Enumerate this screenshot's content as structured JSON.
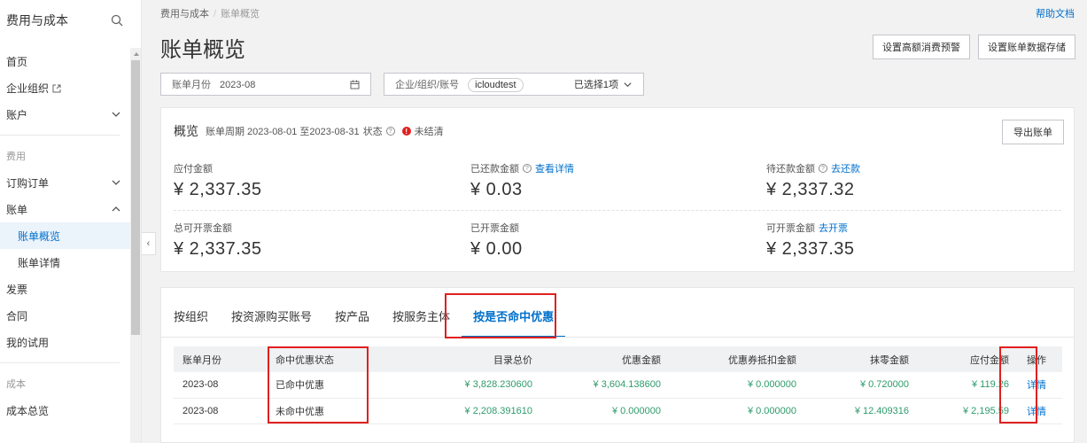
{
  "sidebar": {
    "title": "费用与成本",
    "items": [
      {
        "label": "首页"
      },
      {
        "label": "企业组织"
      },
      {
        "label": "账户"
      }
    ],
    "group_fee": "费用",
    "fee_items": [
      {
        "label": "订购订单"
      },
      {
        "label": "账单"
      },
      {
        "label": "账单概览"
      },
      {
        "label": "账单详情"
      },
      {
        "label": "发票"
      },
      {
        "label": "合同"
      },
      {
        "label": "我的试用"
      }
    ],
    "group_cost": "成本",
    "cost_items": [
      {
        "label": "成本总览"
      }
    ]
  },
  "breadcrumb": {
    "root": "费用与成本",
    "current": "账单概览"
  },
  "help_link": "帮助文档",
  "page_title": "账单概览",
  "buttons": {
    "alert": "设置高额消费预警",
    "storage": "设置账单数据存储",
    "export": "导出账单"
  },
  "filters": {
    "month_label": "账单月份",
    "month_value": "2023-08",
    "org_label": "企业/组织/账号",
    "org_tag": "icloudtest",
    "org_selected": "已选择1项"
  },
  "overview": {
    "title": "概览",
    "period": "账单周期 2023-08-01 至2023-08-31",
    "status_label": "状态",
    "status_value": "未结清",
    "metrics": [
      {
        "label": "应付金额",
        "value": "¥ 2,337.35",
        "link": ""
      },
      {
        "label": "已还款金额",
        "value": "¥ 0.03",
        "link": "查看详情"
      },
      {
        "label": "待还款金额",
        "value": "¥ 2,337.32",
        "link": "去还款"
      },
      {
        "label": "总可开票金额",
        "value": "¥ 2,337.35",
        "link": ""
      },
      {
        "label": "已开票金额",
        "value": "¥ 0.00",
        "link": ""
      },
      {
        "label": "可开票金额",
        "value": "¥ 2,337.35",
        "link": "去开票"
      }
    ]
  },
  "tabs": [
    {
      "label": "按组织"
    },
    {
      "label": "按资源购买账号"
    },
    {
      "label": "按产品"
    },
    {
      "label": "按服务主体"
    },
    {
      "label": "按是否命中优惠"
    }
  ],
  "table": {
    "headers": [
      "账单月份",
      "命中优惠状态",
      "目录总价",
      "优惠金额",
      "优惠券抵扣金额",
      "抹零金额",
      "应付金额",
      "操作"
    ],
    "rows": [
      [
        "2023-08",
        "已命中优惠",
        "¥ 3,828.230600",
        "¥ 3,604.138600",
        "¥ 0.000000",
        "¥ 0.720000",
        "¥ 119.26",
        "详情"
      ],
      [
        "2023-08",
        "未命中优惠",
        "¥ 2,208.391610",
        "¥ 0.000000",
        "¥ 0.000000",
        "¥ 12.409316",
        "¥ 2,195.59",
        "详情"
      ]
    ]
  },
  "colors": {
    "accent": "#0070cc",
    "highlight": "#e02020",
    "amount": "#2d9b6c"
  }
}
